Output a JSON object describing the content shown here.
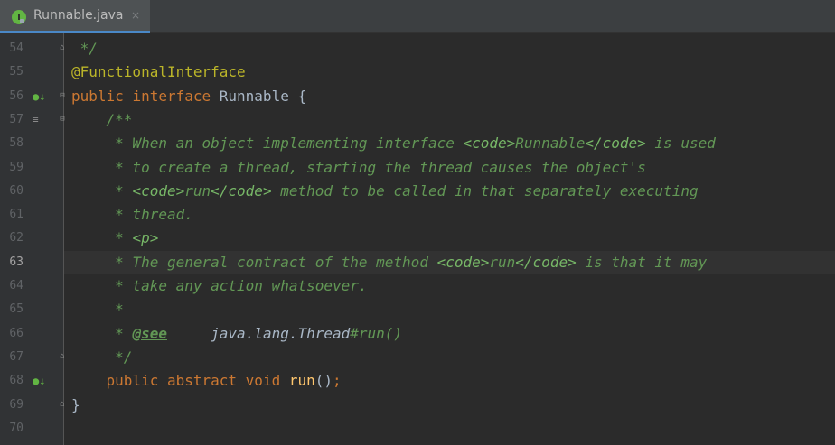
{
  "tab": {
    "label": "Runnable.java",
    "icon": "interface-icon",
    "icon_letter": "I",
    "close_symbol": "×"
  },
  "editor": {
    "current_line": "63",
    "lines": [
      {
        "n": "54",
        "tokens": [
          {
            "c": "doc",
            "t": " */"
          }
        ]
      },
      {
        "n": "55",
        "tokens": [
          {
            "c": "ann",
            "t": "@FunctionalInterface"
          }
        ]
      },
      {
        "n": "56",
        "tokens": [
          {
            "c": "kw",
            "t": "public "
          },
          {
            "c": "kw",
            "t": "interface "
          },
          {
            "c": "",
            "t": "Runnable {"
          }
        ]
      },
      {
        "n": "57",
        "tokens": [
          {
            "c": "doc",
            "t": "    /**"
          }
        ]
      },
      {
        "n": "58",
        "tokens": [
          {
            "c": "doc",
            "t": "     * When an object implementing interface "
          },
          {
            "c": "doctag",
            "t": "<code>"
          },
          {
            "c": "doc",
            "t": "Runnable"
          },
          {
            "c": "doctag",
            "t": "</code>"
          },
          {
            "c": "doc",
            "t": " is used"
          }
        ]
      },
      {
        "n": "59",
        "tokens": [
          {
            "c": "doc",
            "t": "     * to create a thread, starting the thread causes the object's"
          }
        ]
      },
      {
        "n": "60",
        "tokens": [
          {
            "c": "doc",
            "t": "     * "
          },
          {
            "c": "doctag",
            "t": "<code>"
          },
          {
            "c": "doc",
            "t": "run"
          },
          {
            "c": "doctag",
            "t": "</code>"
          },
          {
            "c": "doc",
            "t": " method to be called in that separately executing"
          }
        ]
      },
      {
        "n": "61",
        "tokens": [
          {
            "c": "doc",
            "t": "     * thread."
          }
        ]
      },
      {
        "n": "62",
        "tokens": [
          {
            "c": "doc",
            "t": "     * "
          },
          {
            "c": "doctag",
            "t": "<p>"
          }
        ]
      },
      {
        "n": "63",
        "tokens": [
          {
            "c": "doc",
            "t": "     * The general contract of the method "
          },
          {
            "c": "doctag",
            "t": "<code>"
          },
          {
            "c": "doc",
            "t": "run"
          },
          {
            "c": "doctag",
            "t": "</code>"
          },
          {
            "c": "doc",
            "t": " is that it may"
          }
        ]
      },
      {
        "n": "64",
        "tokens": [
          {
            "c": "doc",
            "t": "     * take any action whatsoever."
          }
        ]
      },
      {
        "n": "65",
        "tokens": [
          {
            "c": "doc",
            "t": "     *"
          }
        ]
      },
      {
        "n": "66",
        "tokens": [
          {
            "c": "doc",
            "t": "     * "
          },
          {
            "c": "doctagb",
            "t": "@see"
          },
          {
            "c": "doc",
            "t": "     "
          },
          {
            "c": "docref",
            "t": "java.lang.Thread"
          },
          {
            "c": "doc",
            "t": "#run()"
          }
        ]
      },
      {
        "n": "67",
        "tokens": [
          {
            "c": "doc",
            "t": "     */"
          }
        ]
      },
      {
        "n": "68",
        "tokens": [
          {
            "c": "",
            "t": "    "
          },
          {
            "c": "kw",
            "t": "public "
          },
          {
            "c": "kw",
            "t": "abstract "
          },
          {
            "c": "kw",
            "t": "void "
          },
          {
            "c": "fn",
            "t": "run"
          },
          {
            "c": "",
            "t": "()"
          },
          {
            "c": "kw",
            "t": ";"
          }
        ]
      },
      {
        "n": "69",
        "tokens": [
          {
            "c": "",
            "t": "}"
          }
        ]
      },
      {
        "n": "70",
        "tokens": []
      }
    ],
    "gutter_icons": {
      "56": "implemented-override-icon",
      "57": "rendered-doc-icon",
      "68": "implemented-override-icon"
    },
    "fold_markers": {
      "54": "fold-end-icon",
      "56": "fold-start-icon",
      "57": "fold-start-icon",
      "67": "fold-end-icon",
      "69": "fold-end-icon"
    }
  },
  "colors": {
    "background": "#2b2b2b",
    "keyword": "#cc7832",
    "annotation": "#bbb529",
    "doc_comment": "#629755",
    "method": "#ffc66d",
    "text": "#a9b7c6"
  }
}
